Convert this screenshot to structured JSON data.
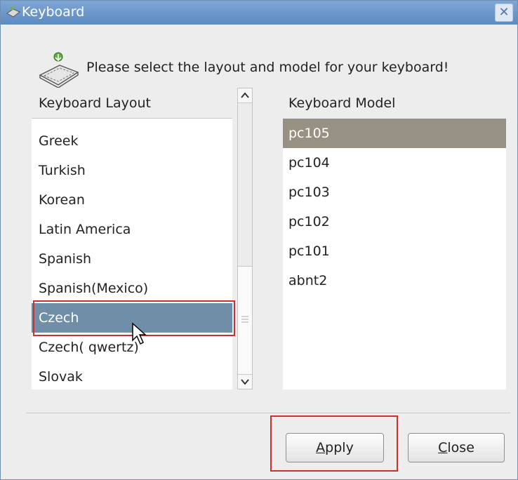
{
  "window": {
    "title": "Keyboard"
  },
  "header": {
    "message": "Please select the layout and model for your keyboard!"
  },
  "layout": {
    "header": "Keyboard Layout",
    "items": [
      "Greek",
      "Turkish",
      "Korean",
      "Latin America",
      "Spanish",
      "Spanish(Mexico)",
      "Czech",
      "Czech( qwertz)",
      "Slovak"
    ],
    "selected": "Czech"
  },
  "model": {
    "header": "Keyboard Model",
    "items": [
      "pc105",
      "pc104",
      "pc103",
      "pc102",
      "pc101",
      "abnt2"
    ],
    "selected": "pc105"
  },
  "buttons": {
    "apply_mnemonic": "A",
    "apply_rest": "pply",
    "close_mnemonic": "C",
    "close_rest": "lose"
  },
  "icons": {
    "app": "keyboard-icon",
    "header": "keyboard-install-icon",
    "close": "close-icon",
    "scroll_up": "arrow-up-icon",
    "scroll_down": "arrow-down-icon",
    "cursor": "mouse-cursor-icon"
  },
  "colors": {
    "titlebar": "#6f97c9",
    "layout_selection": "#6f8ea7",
    "model_selection": "#969182",
    "annotation": "#cc2f2f"
  }
}
